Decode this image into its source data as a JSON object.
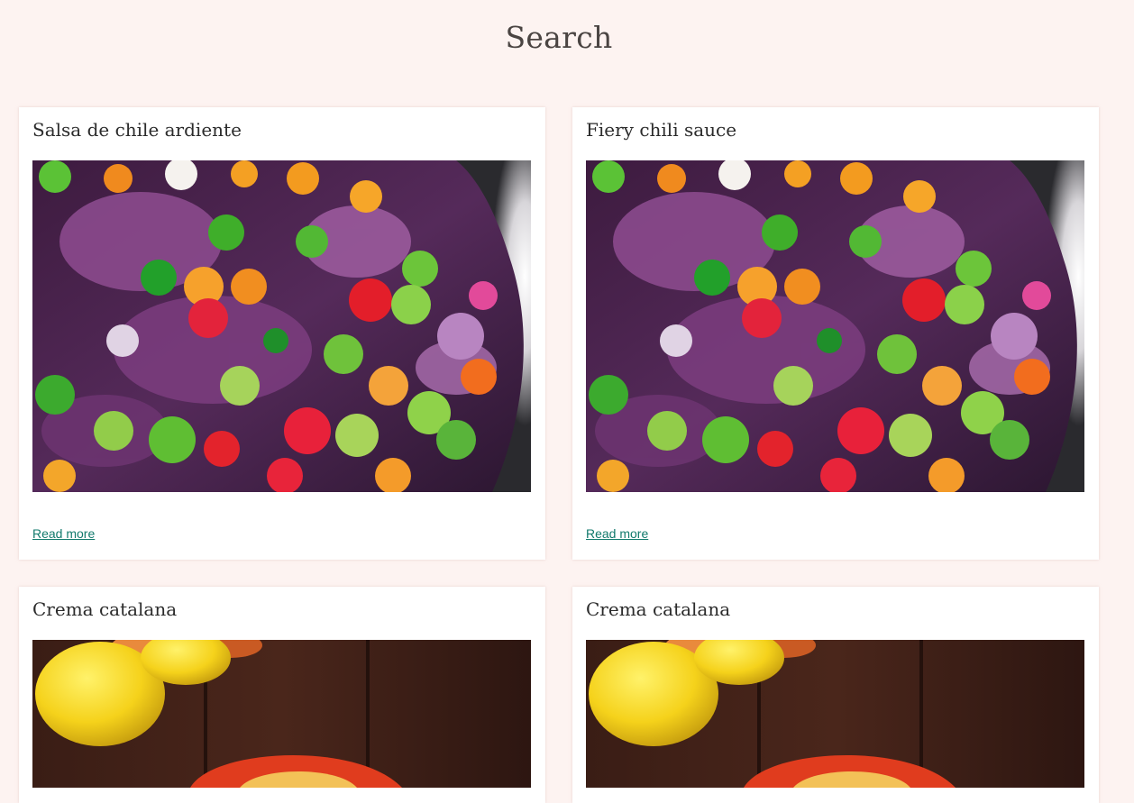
{
  "page": {
    "title": "Search"
  },
  "results": [
    {
      "title": "Salsa de chile ardiente",
      "image": "chili-peppers-and-onions",
      "read_more": "Read more"
    },
    {
      "title": "Fiery chili sauce",
      "image": "chili-peppers-and-onions",
      "read_more": "Read more"
    },
    {
      "title": "Crema catalana",
      "image": "crema-catalana-with-lemons"
    },
    {
      "title": "Crema catalana",
      "image": "crema-catalana-with-lemons"
    }
  ],
  "colors": {
    "background": "#fdf3f1",
    "card": "#ffffff",
    "link": "#127a6c",
    "title": "#4a4442"
  }
}
